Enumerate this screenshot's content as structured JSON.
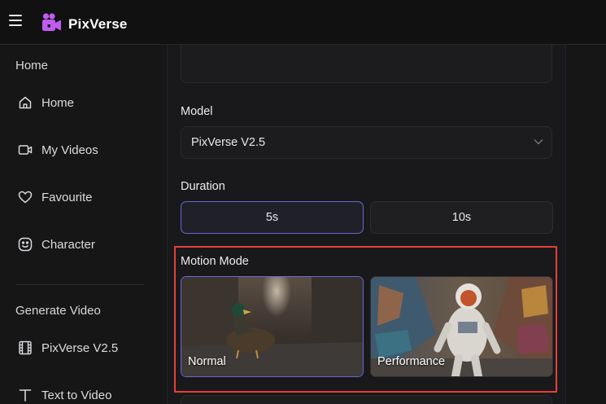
{
  "header": {
    "brand": "PixVerse",
    "logo_icon": "film-camera-logo-icon",
    "menu_icon": "hamburger-menu-icon"
  },
  "sidebar": {
    "section_home": "Home",
    "items_home": [
      {
        "label": "Home",
        "icon": "home-icon"
      },
      {
        "label": "My Videos",
        "icon": "video-camera-icon"
      },
      {
        "label": "Favourite",
        "icon": "heart-icon"
      },
      {
        "label": "Character",
        "icon": "smiley-face-icon"
      }
    ],
    "section_generate": "Generate Video",
    "items_generate": [
      {
        "label": "PixVerse V2.5",
        "icon": "film-strip-icon"
      },
      {
        "label": "Text to Video",
        "icon": "text-icon"
      }
    ]
  },
  "form": {
    "model_label": "Model",
    "model_value": "PixVerse V2.5",
    "duration_label": "Duration",
    "duration_options": [
      {
        "label": "5s",
        "selected": true
      },
      {
        "label": "10s",
        "selected": false
      }
    ],
    "motion_mode_label": "Motion Mode",
    "motion_modes": [
      {
        "label": "Normal",
        "selected": true
      },
      {
        "label": "Performance",
        "selected": false
      }
    ]
  },
  "colors": {
    "accent": "#6a66d8",
    "highlight": "#e5403a",
    "logo": "#c05df0"
  }
}
